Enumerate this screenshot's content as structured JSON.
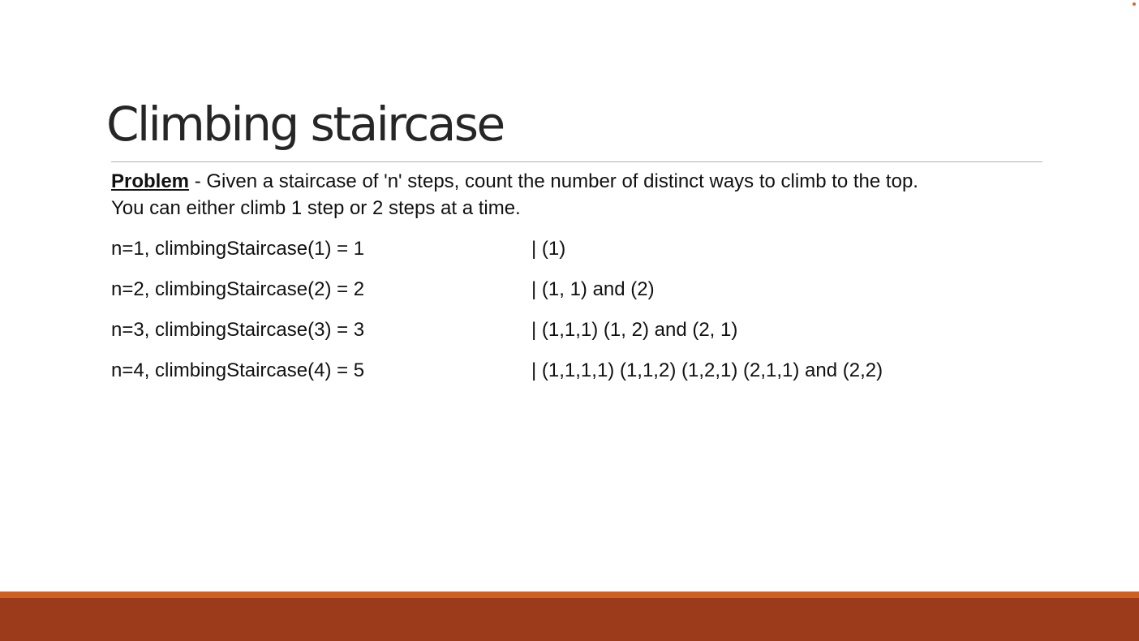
{
  "slide": {
    "title": "Climbing staircase",
    "problem": {
      "label": "Problem",
      "text": " - Given a staircase of 'n' steps, count the number of distinct ways to climb to the top.",
      "line2": "You can either climb 1 step or 2 steps at a time."
    },
    "examples": [
      {
        "left": "n=1, climbingStaircase(1) = 1",
        "right": "| (1)"
      },
      {
        "left": "n=2, climbingStaircase(2) = 2",
        "right": "| (1, 1) and (2)"
      },
      {
        "left": "n=3, climbingStaircase(3) = 3",
        "right": "| (1,1,1) (1, 2) and (2, 1)"
      },
      {
        "left": "n=4, climbingStaircase(4) = 5",
        "right": "| (1,1,1,1) (1,1,2) (1,2,1) (2,1,1) and (2,2)"
      }
    ]
  },
  "colors": {
    "footer_accent": "#d06020",
    "footer_bar": "#9b3b1c",
    "title_text": "#262626"
  }
}
